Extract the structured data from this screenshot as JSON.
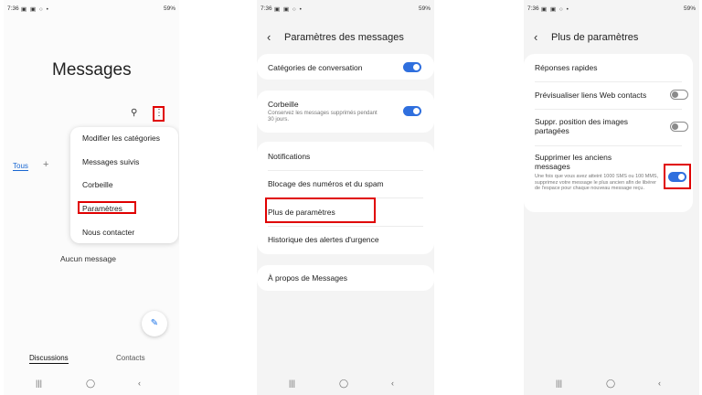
{
  "status": {
    "time": "7:36",
    "notif_icons": "▣ ▣ ○ •",
    "signal_battery": "59%"
  },
  "navbar": {
    "recent_icon": "|||",
    "home_icon": "◯",
    "back_icon": "‹"
  },
  "screen1": {
    "title": "Messages",
    "search_icon": "⚲",
    "more_icon": "⋮",
    "menu": [
      {
        "label": "Modifier les catégories"
      },
      {
        "label": "Messages suivis"
      },
      {
        "label": "Corbeille"
      },
      {
        "label": "Paramètres"
      },
      {
        "label": "Nous contacter"
      }
    ],
    "tab_all": "Tous",
    "add_icon": "+",
    "empty_text": "Aucun message",
    "compose_icon": "✎",
    "bottom_tabs": [
      "Discussions",
      "Contacts"
    ]
  },
  "screen2": {
    "back_icon": "‹",
    "title": "Paramètres des messages",
    "rows": [
      {
        "label": "Catégories de conversation",
        "toggle": true
      },
      {
        "label": "Corbeille",
        "sub": "Conservez les messages supprimés pendant 30 jours.",
        "toggle": true
      },
      {
        "label": "Notifications"
      },
      {
        "label": "Blocage des numéros et du spam"
      },
      {
        "label": "Plus de paramètres"
      },
      {
        "label": "Historique des alertes d'urgence"
      },
      {
        "label": "À propos de Messages"
      }
    ]
  },
  "screen3": {
    "back_icon": "‹",
    "title": "Plus de paramètres",
    "rows": [
      {
        "label": "Réponses rapides"
      },
      {
        "label": "Prévisualiser liens Web contacts",
        "toggle": false
      },
      {
        "label": "Suppr. position des images partagées",
        "toggle": false
      },
      {
        "label": "Supprimer les anciens messages",
        "sub": "Une fois que vous avez atteint 1000 SMS ou 100 MMS, supprimez votre message le plus ancien afin de libérer de l'espace pour chaque nouveau message reçu.",
        "toggle": true
      }
    ]
  },
  "colors": {
    "accent": "#2f6fde",
    "highlight": "#e00000"
  }
}
